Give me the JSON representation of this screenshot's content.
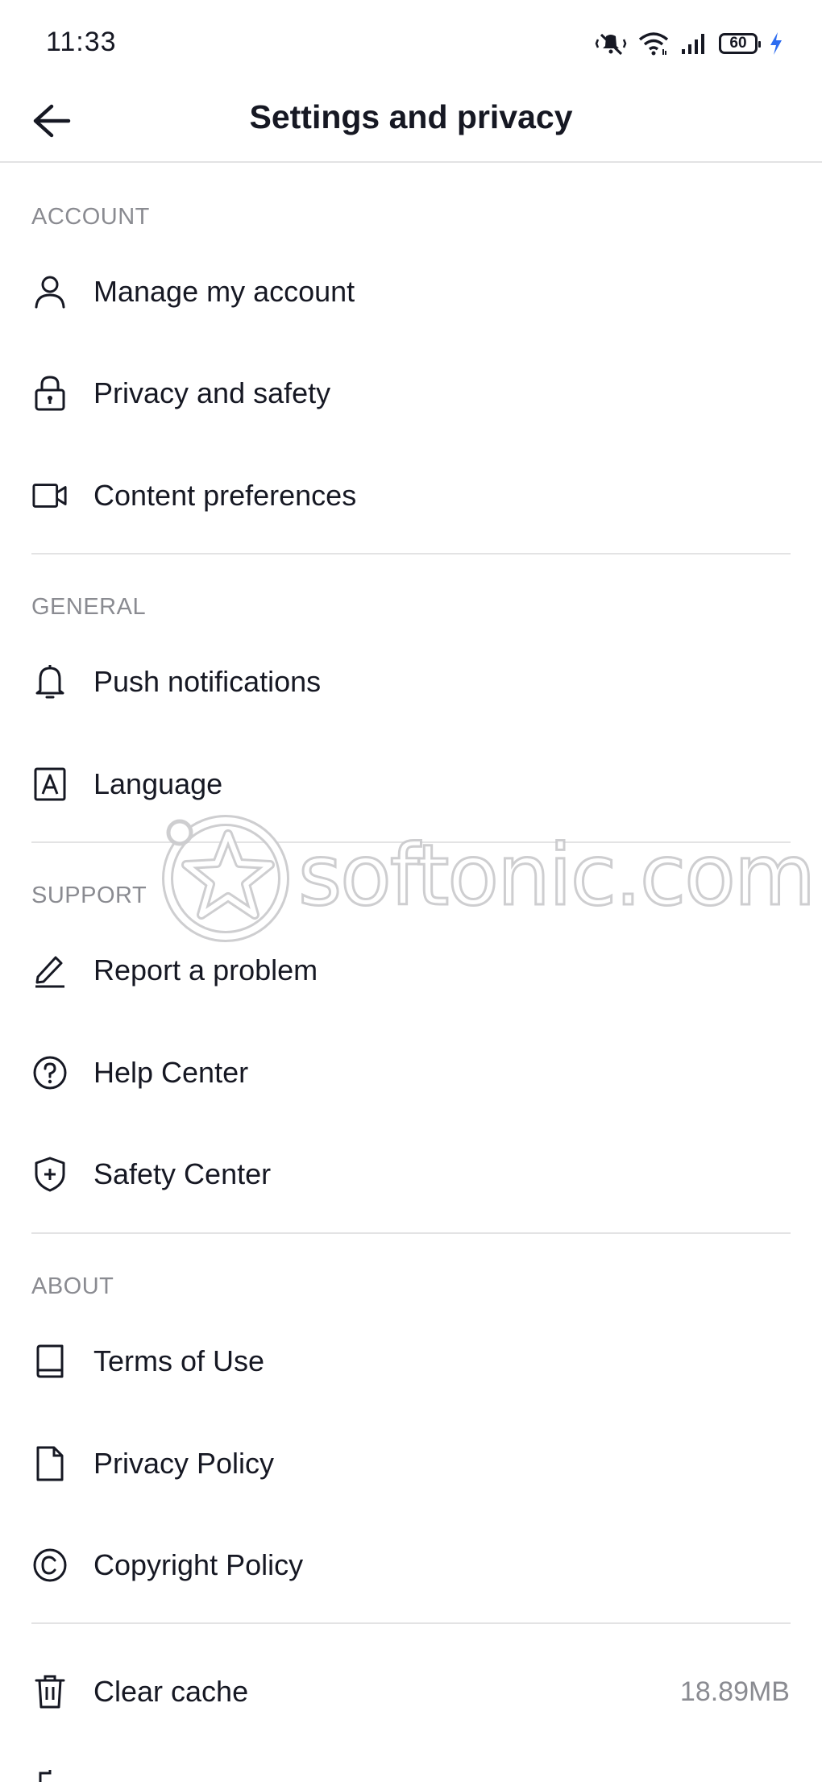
{
  "status_bar": {
    "time": "11:33",
    "battery": "60"
  },
  "header": {
    "title": "Settings and privacy",
    "back_icon": "arrow-left-icon"
  },
  "sections": {
    "account": {
      "title": "ACCOUNT",
      "items": [
        {
          "label": "Manage my account",
          "icon": "person-icon"
        },
        {
          "label": "Privacy and safety",
          "icon": "lock-icon"
        },
        {
          "label": "Content preferences",
          "icon": "video-camera-icon"
        }
      ]
    },
    "general": {
      "title": "GENERAL",
      "items": [
        {
          "label": "Push notifications",
          "icon": "bell-icon"
        },
        {
          "label": "Language",
          "icon": "letter-a-icon"
        }
      ]
    },
    "support": {
      "title": "SUPPORT",
      "items": [
        {
          "label": "Report a problem",
          "icon": "pencil-icon"
        },
        {
          "label": "Help Center",
          "icon": "question-circle-icon"
        },
        {
          "label": "Safety Center",
          "icon": "shield-plus-icon"
        }
      ]
    },
    "about": {
      "title": "ABOUT",
      "items": [
        {
          "label": "Terms of Use",
          "icon": "book-icon"
        },
        {
          "label": "Privacy Policy",
          "icon": "document-icon"
        },
        {
          "label": "Copyright Policy",
          "icon": "copyright-icon"
        }
      ]
    },
    "other": {
      "items": [
        {
          "label": "Clear cache",
          "value": "18.89MB",
          "icon": "trash-icon"
        }
      ]
    }
  },
  "watermark": {
    "text": "softonic.com"
  },
  "colors": {
    "text": "#161823",
    "secondary": "#8a8b91",
    "divider": "#e3e3e4",
    "charging": "#2d6cf0"
  }
}
